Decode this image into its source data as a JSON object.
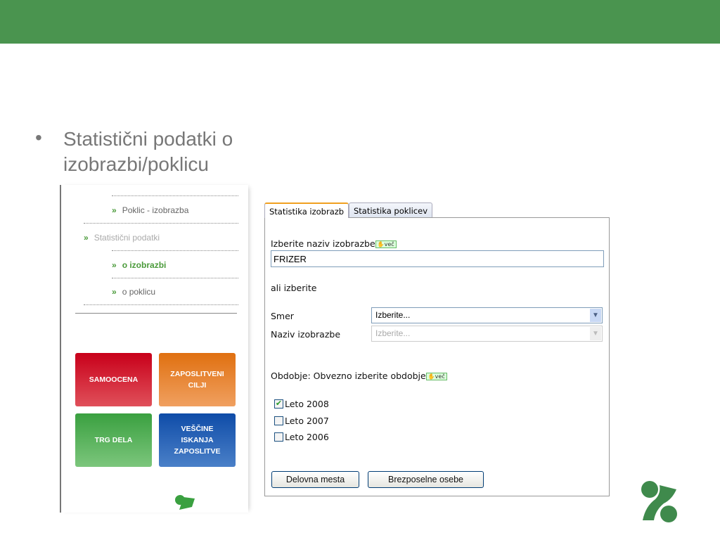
{
  "slide": {
    "bullet": "•",
    "text": "Statistični podatki o izobrazbi/poklicu"
  },
  "nav": [
    {
      "label": "Poklic - izobrazba",
      "marker": "»"
    },
    {
      "label": "Statistični podatki",
      "marker": "»"
    },
    {
      "label": "o izobrazbi",
      "marker": "»"
    },
    {
      "label": "o poklicu",
      "marker": "»"
    }
  ],
  "tiles": {
    "samoocena": "SAMOOCENA",
    "cilji": "ZAPOSLITVENI CILJI",
    "trg": "TRG DELA",
    "vescine": "VEŠČINE ISKANJA ZAPOSLITVE"
  },
  "tabs": [
    "Statistika izobrazb",
    "Statistika poklicev"
  ],
  "form": {
    "name_label": "Izberite naziv izobrazbe",
    "more": "več",
    "name_value": "FRIZER",
    "or_label": "ali izberite",
    "smer_label": "Smer",
    "smer_value": "Izberite...",
    "naziv_label": "Naziv izobrazbe",
    "naziv_value": "Izberite...",
    "period_label": "Obdobje: Obvezno izberite obdobje",
    "years": [
      {
        "label": "Leto 2008",
        "checked": true
      },
      {
        "label": "Leto 2007",
        "checked": false
      },
      {
        "label": "Leto 2006",
        "checked": false
      }
    ],
    "btn1": "Delovna mesta",
    "btn2": "Brezposelne osebe"
  }
}
